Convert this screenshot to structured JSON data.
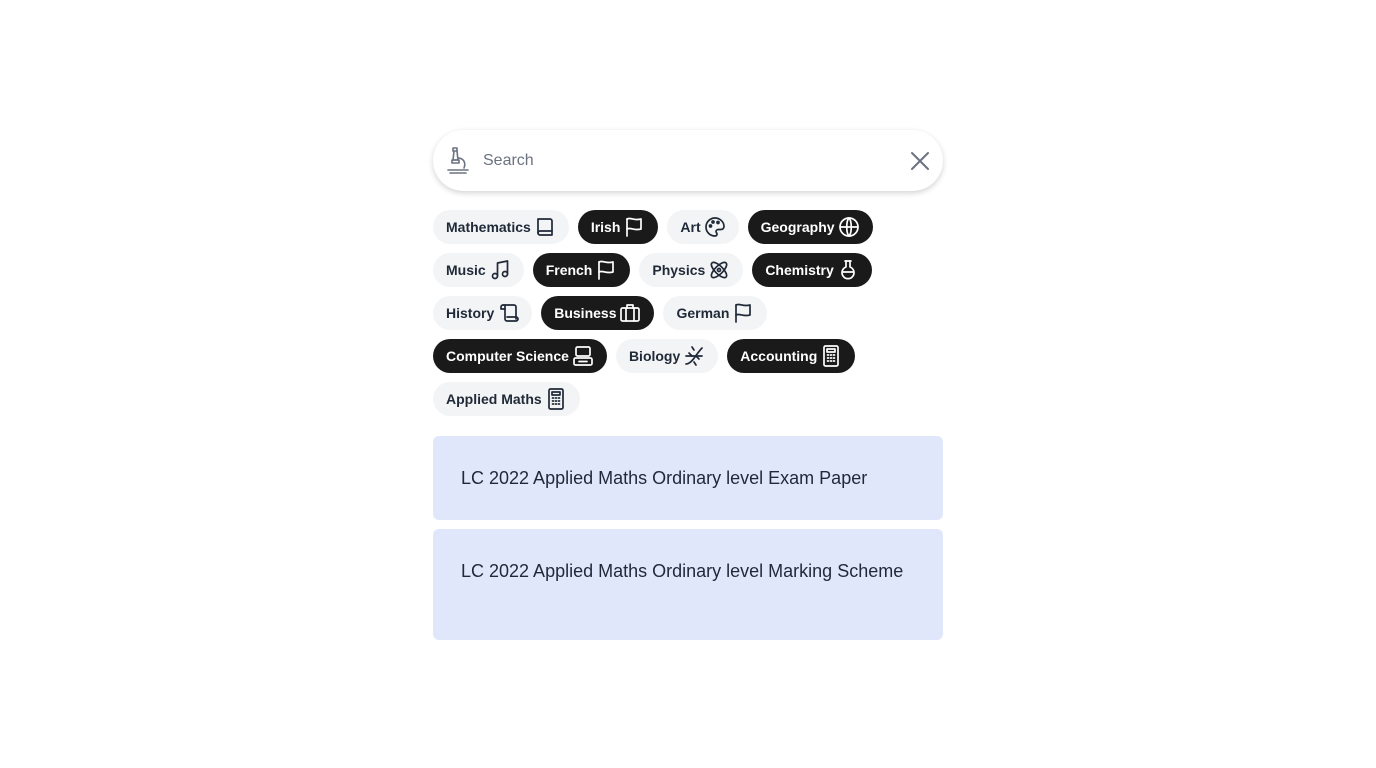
{
  "search": {
    "placeholder": "Search",
    "value": "",
    "lead_icon": "microscope-icon",
    "clear_icon": "close-icon"
  },
  "subjects": [
    {
      "label": "Mathematics",
      "selected": false,
      "icon": "book-icon"
    },
    {
      "label": "Irish",
      "selected": true,
      "icon": "flag-icon"
    },
    {
      "label": "Art",
      "selected": false,
      "icon": "palette-icon"
    },
    {
      "label": "Geography",
      "selected": true,
      "icon": "globe-icon"
    },
    {
      "label": "Music",
      "selected": false,
      "icon": "music-note-icon"
    },
    {
      "label": "French",
      "selected": true,
      "icon": "flag-icon"
    },
    {
      "label": "Physics",
      "selected": false,
      "icon": "atom-icon"
    },
    {
      "label": "Chemistry",
      "selected": true,
      "icon": "flask-icon"
    },
    {
      "label": "History",
      "selected": false,
      "icon": "scroll-icon"
    },
    {
      "label": "Business",
      "selected": true,
      "icon": "briefcase-icon"
    },
    {
      "label": "German",
      "selected": false,
      "icon": "flag-icon"
    },
    {
      "label": "Computer Science",
      "selected": true,
      "icon": "computer-icon"
    },
    {
      "label": "Biology",
      "selected": false,
      "icon": "dna-icon"
    },
    {
      "label": "Accounting",
      "selected": true,
      "icon": "calculator-icon"
    },
    {
      "label": "Applied Maths",
      "selected": false,
      "icon": "calculator-icon"
    }
  ],
  "results": [
    {
      "title": "LC 2022 Applied Maths Ordinary level Exam Paper"
    },
    {
      "title": "LC 2022 Applied Maths Ordinary level Marking Scheme"
    }
  ],
  "colors": {
    "chip_selected_bg": "#1a1a1a",
    "chip_unselected_bg": "#f3f4f6",
    "result_bg": "#e0e7fb"
  }
}
